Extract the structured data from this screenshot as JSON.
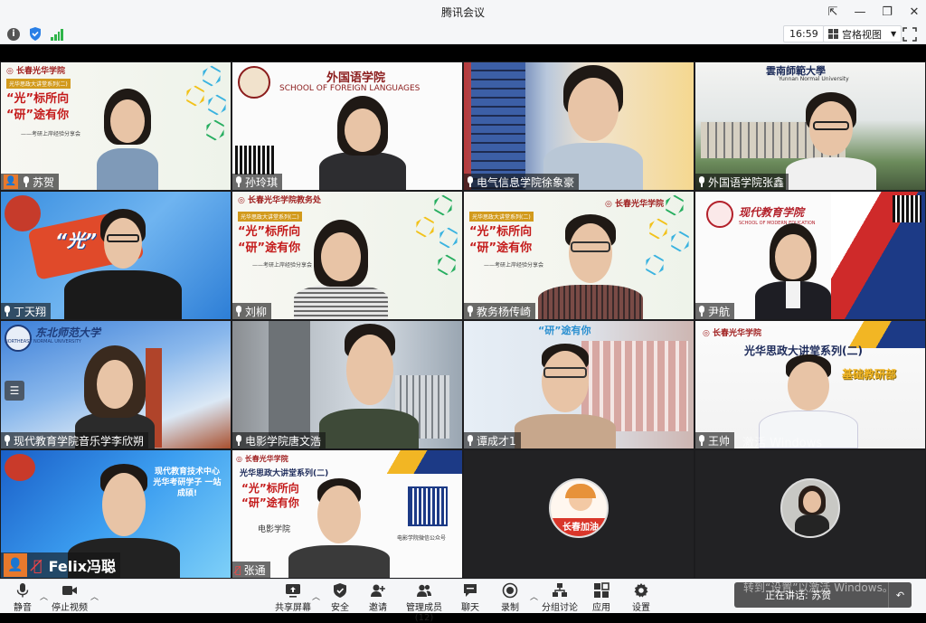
{
  "window": {
    "title": "腾讯会议"
  },
  "infobar": {
    "time": "16:59",
    "view_label": "宫格视图"
  },
  "tiles": [
    {
      "name": "苏贺",
      "banner_title": "“光”标所向 “研”途有你",
      "banner_sub": "——考研上岸经验分享会",
      "banner_tag": "光华思政大讲堂系列(二)"
    },
    {
      "name": "孙玲琪",
      "school_cn": "外国语学院",
      "school_en": "SCHOOL OF FOREIGN LANGUAGES"
    },
    {
      "name": "电气信息学院徐象豪"
    },
    {
      "name": "外国语学院张鑫",
      "univ_cn": "雲南師範大學",
      "univ_en": "Yunnan Normal University"
    },
    {
      "name": "丁天翔"
    },
    {
      "name": "刘柳",
      "banner_title": "“光”标所向 “研”途有你",
      "banner_sub": "——考研上岸经验分享会",
      "banner_tag": "光华思政大讲堂系列(二)"
    },
    {
      "name": "教务杨传崎",
      "banner_title": "“光”标所向 “研”途有你",
      "banner_sub": "——考研上岸经验分享会",
      "banner_tag": "光华思政大讲堂系列(二)"
    },
    {
      "name": "尹航",
      "school_cn": "现代教育学院",
      "school_en": "SCHOOL OF MODERN EDUCATION"
    },
    {
      "name": "现代教育学院音乐学李欣朔",
      "univ_cn": "东北师范大学",
      "univ_en": "NORTHEAST NORMAL UNIVERSITY"
    },
    {
      "name": "电影学院唐文浩"
    },
    {
      "name": "谭成才1",
      "banner_title": "“研”途有你"
    },
    {
      "name": "王帅",
      "banner_title": "光华思政大讲堂系列(二)",
      "banner_sub": "基础教研部",
      "watermark": "激活 Windows"
    },
    {
      "name": "Felix冯聪",
      "slogan": "现代教育技术中心 光华考研学子 一站成硕!"
    },
    {
      "name": "张通",
      "banner_tag": "光华思政大讲堂系列(二)",
      "banner_title": "“光”标所向 “研”途有你",
      "banner_sub": "电影学院",
      "qr_caption": "电影学院微信公众号"
    },
    {
      "name": "",
      "badge": "长春加油"
    },
    {
      "name": ""
    }
  ],
  "toolbar": {
    "mute": "静音",
    "stop_video": "停止视频",
    "share": "共享屏幕",
    "security": "安全",
    "invite": "邀请",
    "members": "管理成员(12)",
    "chat": "聊天",
    "record": "录制",
    "breakout": "分组讨论",
    "apps": "应用",
    "settings": "设置"
  },
  "speaking": {
    "label": "正在讲话: 苏贺"
  },
  "watermark": {
    "text": "转到“设置”以激活 Windows。"
  }
}
